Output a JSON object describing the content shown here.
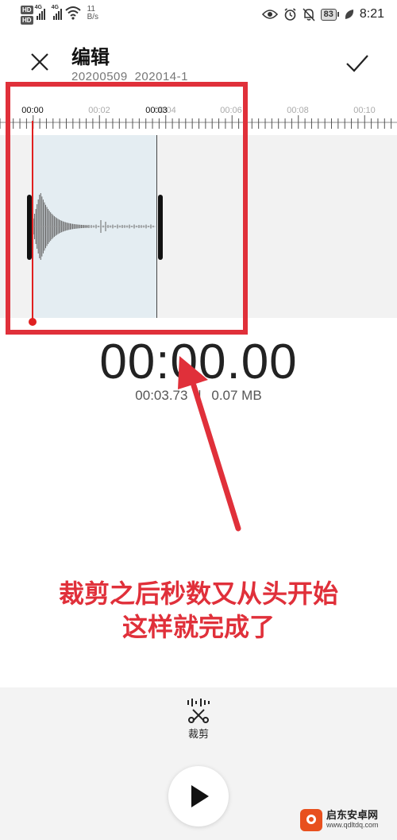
{
  "status_bar": {
    "hd1": "HD",
    "hd2": "HD",
    "net1": "4G",
    "net2": "4G",
    "speed_value": "11",
    "speed_unit": "B/s",
    "battery": "83",
    "time": "8:21"
  },
  "header": {
    "title": "编辑",
    "subtitle": "20200509_202014-1"
  },
  "timeline": {
    "ticks": [
      "00:00",
      "00:02",
      "00:04",
      "00:06",
      "00:08",
      "00:10"
    ],
    "selection_end_label": "00:03"
  },
  "readout": {
    "current_time": "00:00.00",
    "duration": "00:03.73",
    "separator": "|",
    "file_size": "0.07 MB"
  },
  "annotation": {
    "line1": "裁剪之后秒数又从头开始",
    "line2": "这样就完成了"
  },
  "toolbar": {
    "trim_label": "裁剪"
  },
  "watermark": {
    "name": "启东安卓网",
    "url": "www.qdltdq.com"
  },
  "colors": {
    "accent_red": "#e0303a",
    "playhead": "#e02020",
    "selection_bg": "#e4edf2"
  }
}
